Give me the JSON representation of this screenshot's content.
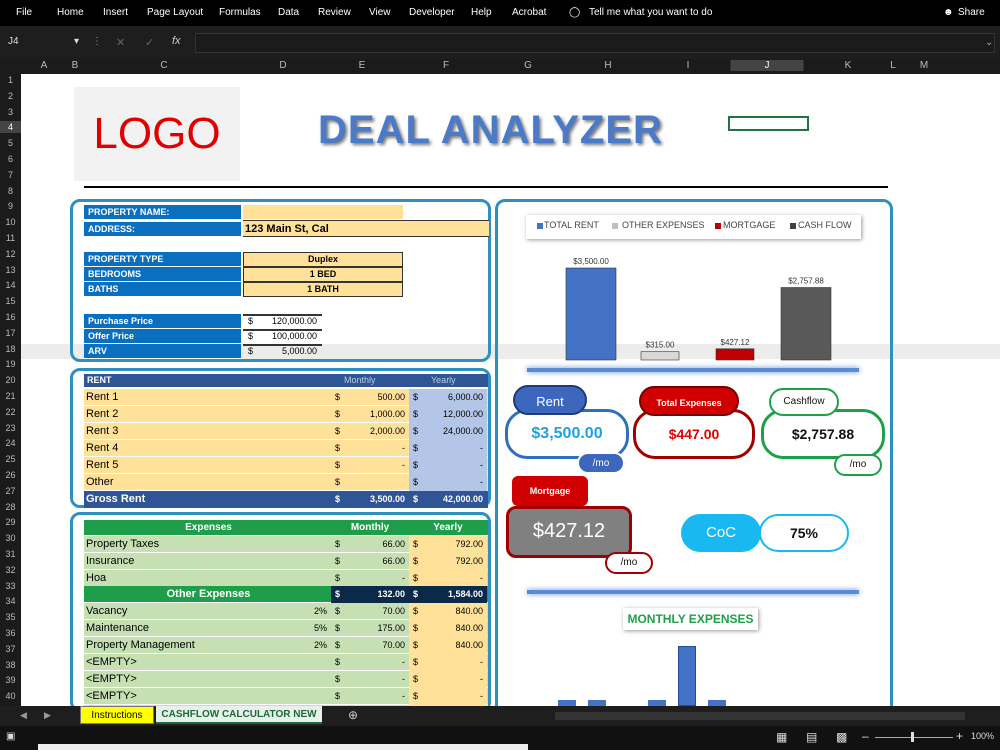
{
  "menu": [
    "File",
    "Home",
    "Insert",
    "Page Layout",
    "Formulas",
    "Data",
    "Review",
    "View",
    "Developer",
    "Help",
    "Acrobat",
    "Tell me what you want to do"
  ],
  "share": "Share",
  "namebox": "J4",
  "fx": "fx",
  "cols": [
    "A",
    "B",
    "C",
    "D",
    "E",
    "F",
    "G",
    "H",
    "I",
    "J",
    "K",
    "L",
    "M"
  ],
  "rows": [
    "1",
    "2",
    "3",
    "4",
    "5",
    "6",
    "7",
    "8",
    "9",
    "10",
    "11",
    "12",
    "13",
    "14",
    "15",
    "16",
    "17",
    "18",
    "19",
    "20",
    "21",
    "22",
    "23",
    "24",
    "25",
    "26",
    "27",
    "28",
    "29",
    "30",
    "31",
    "32",
    "33",
    "34",
    "35",
    "36",
    "37",
    "38",
    "39",
    "40"
  ],
  "logo": "LOGO",
  "title": "DEAL ANALYZER",
  "property": {
    "name_label": "PROPERTY NAME:",
    "address_label": "ADDRESS:",
    "address": "123 Main St, Cal",
    "type_label": "PROPERTY TYPE",
    "type": "Duplex",
    "bed_label": "BEDROOMS",
    "beds": "1 BED",
    "bath_label": "BATHS",
    "baths": "1 BATH",
    "purchase_label": "Purchase Price",
    "purchase": "120,000.00",
    "offer_label": "Offer Price",
    "offer": "100,000.00",
    "arv_label": "ARV",
    "arv": "5,000.00",
    "dollar": "$"
  },
  "rent": {
    "header": [
      "RENT",
      "Monthly",
      "Yearly"
    ],
    "rows": [
      {
        "label": "Rent 1",
        "m": "500.00",
        "y": "6,000.00"
      },
      {
        "label": "Rent 2",
        "m": "1,000.00",
        "y": "12,000.00"
      },
      {
        "label": "Rent 3",
        "m": "2,000.00",
        "y": "24,000.00"
      },
      {
        "label": "Rent 4",
        "m": "-",
        "y": "-"
      },
      {
        "label": "Rent 5",
        "m": "-",
        "y": "-"
      },
      {
        "label": "Other",
        "m": "",
        "y": "-"
      }
    ],
    "total": {
      "label": "Gross Rent",
      "m": "3,500.00",
      "y": "42,000.00"
    }
  },
  "expenses": {
    "header": [
      "Expenses",
      "Monthly",
      "Yearly"
    ],
    "rows": [
      {
        "label": "Property Taxes",
        "pct": "",
        "m": "66.00",
        "y": "792.00"
      },
      {
        "label": "Insurance",
        "pct": "",
        "m": "66.00",
        "y": "792.00"
      },
      {
        "label": "Hoa",
        "pct": "",
        "m": "-",
        "y": "-"
      }
    ],
    "other_header": {
      "label": "Other Expenses",
      "m": "132.00",
      "y": "1,584.00"
    },
    "other_rows": [
      {
        "label": "Vacancy",
        "pct": "2%",
        "m": "70.00",
        "y": "840.00"
      },
      {
        "label": "Maintenance",
        "pct": "5%",
        "m": "175.00",
        "y": "840.00"
      },
      {
        "label": "Property Management",
        "pct": "2%",
        "m": "70.00",
        "y": "840.00"
      },
      {
        "label": "<EMPTY>",
        "pct": "",
        "m": "-",
        "y": "-"
      },
      {
        "label": "<EMPTY>",
        "pct": "",
        "m": "-",
        "y": "-"
      },
      {
        "label": "<EMPTY>",
        "pct": "",
        "m": "-",
        "y": "-"
      },
      {
        "label": "<EMPTY>",
        "pct": "",
        "m": "-",
        "y": "-"
      }
    ]
  },
  "chart_data": {
    "type": "bar",
    "categories": [
      "TOTAL RENT",
      "OTHER EXPENSES",
      "MORTGAGE",
      "CASH FLOW"
    ],
    "values": [
      3500.0,
      315.0,
      427.12,
      2757.88
    ],
    "labels": [
      "$3,500.00",
      "$315.00",
      "$427.12",
      "$2,757.88"
    ],
    "colors": [
      "#4472c4",
      "#d9d9d9",
      "#c00000",
      "#595959"
    ],
    "legend": "top"
  },
  "summary": {
    "rent_label": "Rent",
    "rent": "$3,500.00",
    "per_mo": "/mo",
    "exp_label": "Total Expenses",
    "exp": "$447.00",
    "cf_label": "Cashflow",
    "cf": "$2,757.88",
    "mort_label": "Mortgage",
    "mort": "$427.12",
    "coc_label": "CoC",
    "coc": "75%"
  },
  "monthly_expenses_title": "MONTHLY EXPENSES",
  "tabs": [
    "Instructions",
    "CASHFLOW CALCULATOR NEW"
  ],
  "zoom": "100%"
}
